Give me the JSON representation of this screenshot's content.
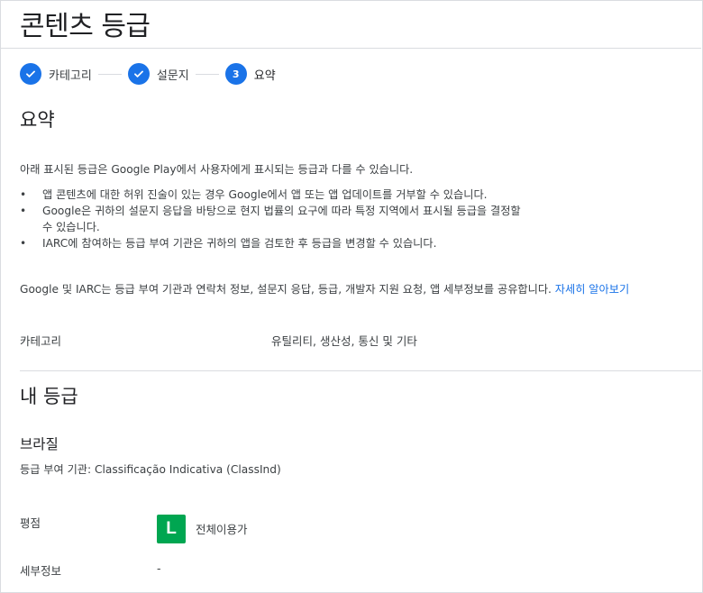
{
  "page": {
    "title": "콘텐츠 등급"
  },
  "stepper": {
    "steps": [
      {
        "label": "카테고리",
        "state": "done"
      },
      {
        "label": "설문지",
        "state": "done"
      },
      {
        "label": "요약",
        "state": "active",
        "number": "3"
      }
    ]
  },
  "summary": {
    "title": "요약",
    "intro": "아래 표시된 등급은 Google Play에서 사용자에게 표시되는 등급과 다를 수 있습니다.",
    "bullets": [
      "앱 콘텐츠에 대한 허위 진술이 있는 경우 Google에서 앱 또는 앱 업데이트를 거부할 수 있습니다.",
      "Google은 귀하의 설문지 응답을 바탕으로 현지 법률의 요구에 따라 특정 지역에서 표시될 등급을 결정할 수 있습니다.",
      "IARC에 참여하는 등급 부여 기관은 귀하의 앱을 검토한 후 등급을 변경할 수 있습니다."
    ],
    "sharing_text": "Google 및 IARC는 등급 부여 기관과 연락처 정보, 설문지 응답, 등급, 개발자 지원 요청, 앱 세부정보를 공유합니다.",
    "learn_more": "자세히 알아보기",
    "category_label": "카테고리",
    "category_value": "유틸리티, 생산성, 통신 및 기타"
  },
  "my_rating": {
    "title": "내 등급",
    "country": "브라질",
    "authority": "등급 부여 기관: Classificação Indicativa (ClassInd)",
    "rating_label": "평점",
    "rating_badge": "L",
    "rating_badge_color": "#00a651",
    "rating_value": "전체이용가",
    "details_label": "세부정보",
    "details_value": "-"
  },
  "colors": {
    "accent": "#1a73e8",
    "divider": "#dadce0"
  }
}
